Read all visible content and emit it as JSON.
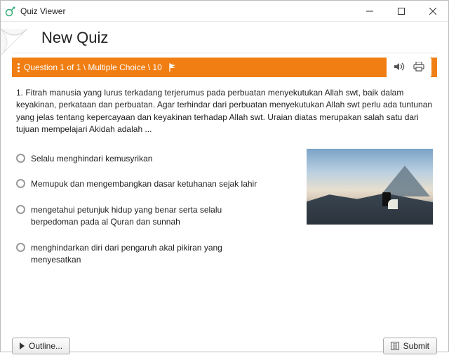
{
  "window": {
    "title": "Quiz Viewer"
  },
  "quiz": {
    "title": "New Quiz"
  },
  "question_bar": {
    "label": "Question 1 of 1 \\ Multiple Choice \\ 10"
  },
  "question": {
    "text": "1. Fitrah manusia yang lurus terkadang terjerumus pada perbuatan menyekutukan Allah swt, baik dalam keyakinan, perkataan dan perbuatan. Agar terhindar dari perbuatan menyekutukan Allah swt perlu ada tuntunan yang jelas tentang kepercayaan dan keyakinan terhadap Allah swt. Uraian diatas merupakan salah satu dari tujuan mempelajari Akidah adalah ..."
  },
  "options": [
    {
      "text": "Selalu menghindari kemusyrikan"
    },
    {
      "text": "Memupuk dan mengembangkan dasar ketuhanan sejak lahir"
    },
    {
      "text": "mengetahui petunjuk hidup yang benar serta selalu berpedoman pada al Quran dan sunnah"
    },
    {
      "text": "menghindarkan diri dari pengaruh akal pikiran yang menyesatkan"
    }
  ],
  "buttons": {
    "outline": "Outline...",
    "submit": "Submit"
  },
  "icons": {
    "audio": "audio-icon",
    "print": "print-icon",
    "flag": "flag-icon"
  },
  "colors": {
    "accent": "#f07e13"
  }
}
